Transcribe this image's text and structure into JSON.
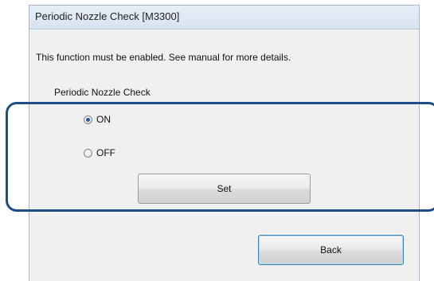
{
  "window": {
    "title": "Periodic Nozzle Check [M3300]"
  },
  "message": "This function must be enabled. See manual for more details.",
  "section_label": "Periodic Nozzle Check",
  "options": [
    {
      "label": "ON",
      "selected": true
    },
    {
      "label": "OFF",
      "selected": false
    }
  ],
  "buttons": {
    "set_label": "Set",
    "back_label": "Back"
  },
  "colors": {
    "highlight": "#1d4f86",
    "radio_selected": "#2a57a8"
  },
  "icons": {
    "radio_on": "radio-selected",
    "radio_off": "radio-unselected"
  }
}
